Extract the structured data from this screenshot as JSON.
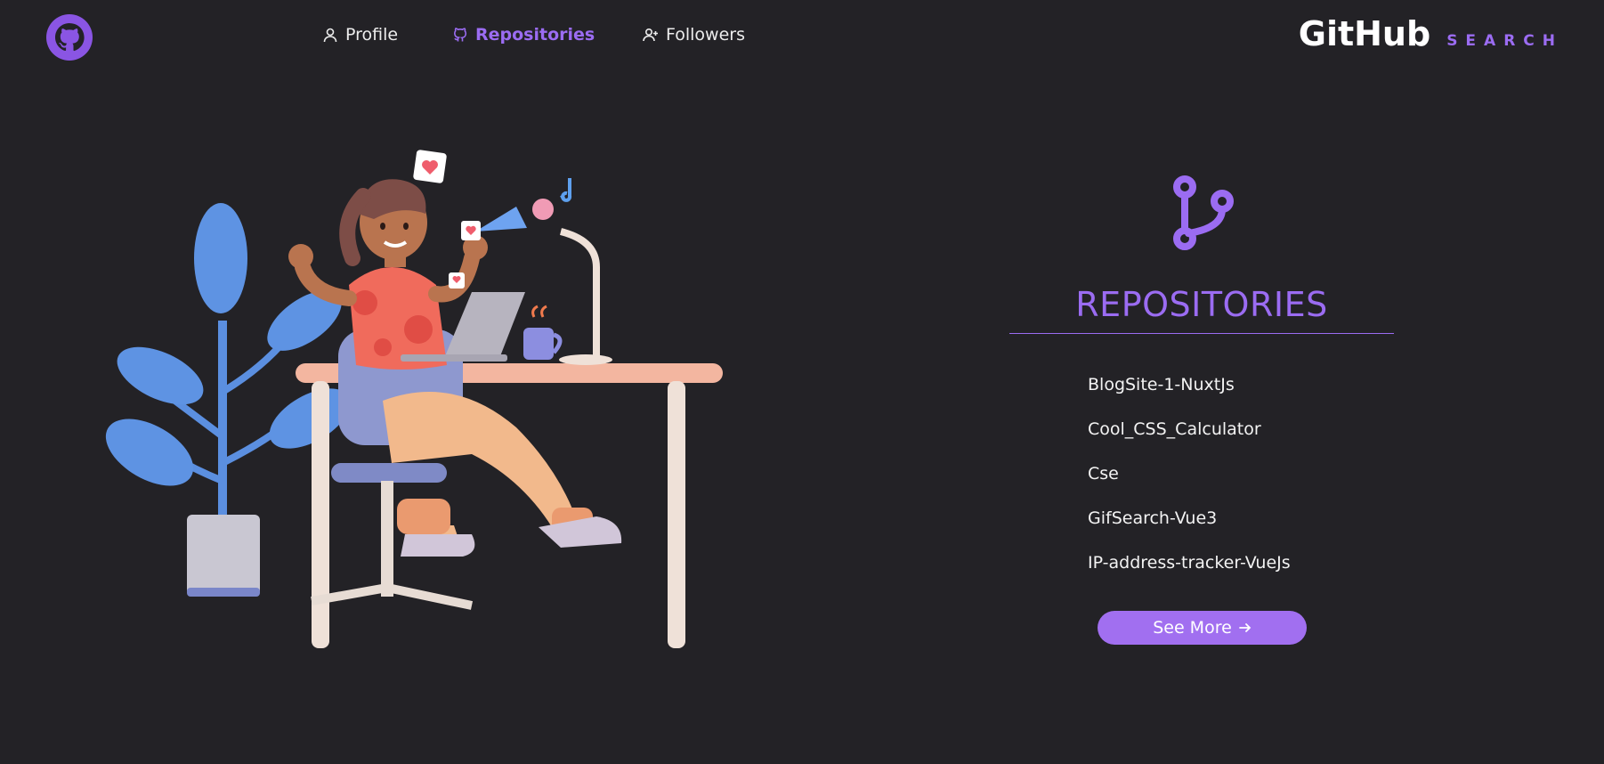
{
  "nav": {
    "links": [
      {
        "label": "Profile",
        "icon": "user-icon",
        "active": false
      },
      {
        "label": "Repositories",
        "icon": "github-icon",
        "active": true
      },
      {
        "label": "Followers",
        "icon": "user-plus-icon",
        "active": false
      }
    ]
  },
  "brand": {
    "title": "GitHub",
    "subtitle": "SEARCH"
  },
  "panel": {
    "icon": "git-branch-icon",
    "title": "REPOSITORIES",
    "repos": [
      "BlogSite-1-NuxtJs",
      "Cool_CSS_Calculator",
      "Cse",
      "GifSearch-Vue3",
      "IP-address-tracker-VueJs"
    ],
    "see_more_label": "See More",
    "see_more_icon": "arrow-right-icon"
  },
  "colors": {
    "accent": "#9b6cf2",
    "background": "#232226",
    "button": "#a16ff0"
  }
}
